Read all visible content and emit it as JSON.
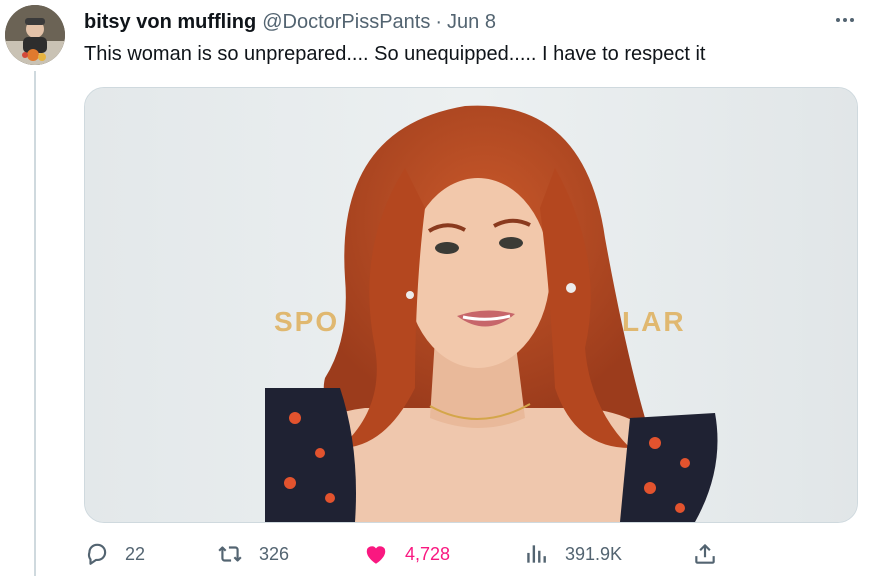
{
  "tweet": {
    "display_name": "bitsy von muffling",
    "handle": "@DoctorPissPants",
    "separator": "·",
    "date": "Jun 8",
    "text": "This woman is so unprepared.... So unequipped..... I have to respect it"
  },
  "media": {
    "backdrop_text_left": "SPO",
    "backdrop_text_right": "LAR",
    "backdrop_text_color": "#e0b870"
  },
  "actions": {
    "replies": "22",
    "retweets": "326",
    "likes": "4,728",
    "views": "391.9K"
  },
  "colors": {
    "primary_text": "#0f1419",
    "secondary_text": "#536471",
    "like_pink": "#f91880",
    "thread_line": "#cfd9de"
  },
  "icons": {
    "more": "more-dots-icon",
    "reply": "reply-bubble-icon",
    "retweet": "retweet-icon",
    "like": "heart-filled-icon",
    "views": "analytics-bars-icon",
    "share": "share-upload-icon"
  }
}
